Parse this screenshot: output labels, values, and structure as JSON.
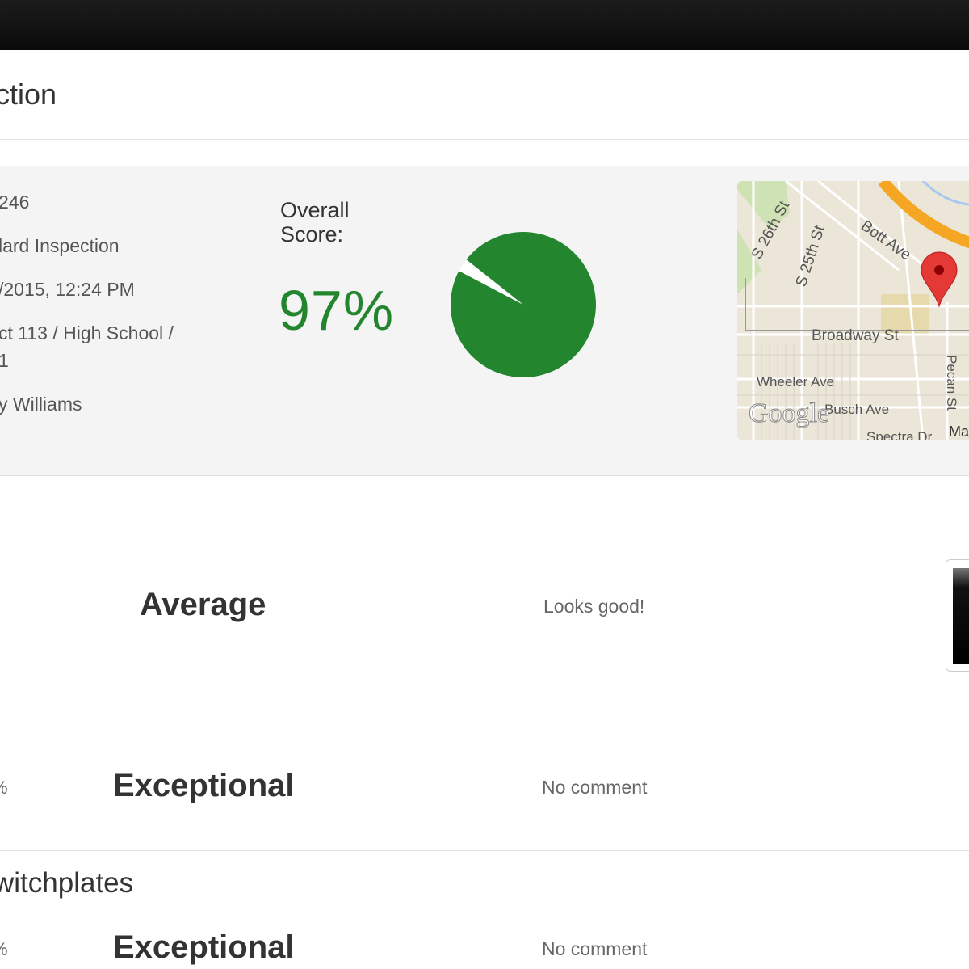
{
  "header": {
    "title": "ction"
  },
  "inspection": {
    "id_fragment": "246",
    "type_fragment": "lard Inspection",
    "datetime_fragment": "/2015, 12:24 PM",
    "location_line1_fragment": "ct 113 / High School /",
    "location_line2_fragment": "1",
    "inspector_fragment": "y Williams"
  },
  "score": {
    "label_line1": "Overall",
    "label_line2": "Score:",
    "value_text": "97%",
    "value": 97,
    "color": "#23862f"
  },
  "map": {
    "labels": {
      "s26": "S 26th St",
      "s25": "S 25th St",
      "bott": "Bott Ave",
      "broadway": "Broadway St",
      "wheeler": "Wheeler Ave",
      "busch": "Busch Ave",
      "pecan": "Pecan St",
      "spectra": "Spectra Dr",
      "ma": "Ma",
      "google": "Google"
    },
    "pin_icon": "map-pin-icon"
  },
  "rows": [
    {
      "rating": "Average",
      "comment": "Looks good!"
    },
    {
      "cut_left": "%",
      "rating": "Exceptional",
      "comment": "No comment"
    },
    {
      "cut_left": "%",
      "rating": "Exceptional",
      "comment": "No comment"
    }
  ],
  "section": {
    "title": "witchplates"
  }
}
